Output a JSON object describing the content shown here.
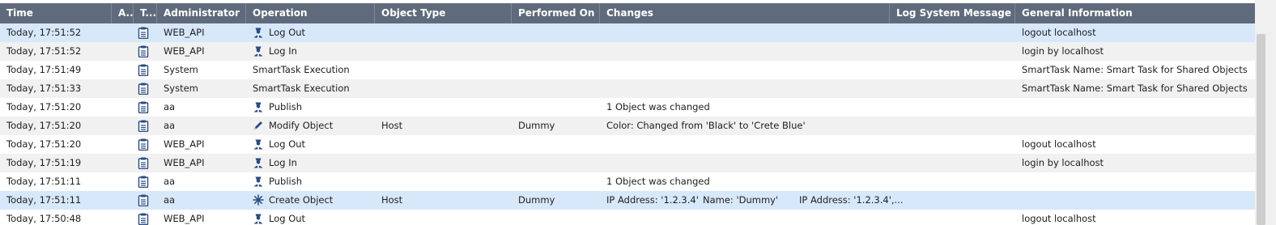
{
  "columns": [
    "Time",
    "A...",
    "T...",
    "Administrator",
    "Operation",
    "Object Type",
    "Performed On",
    "Changes",
    "Log System Message",
    "General Information"
  ],
  "rows": [
    {
      "time": "Today, 17:51:52",
      "admin": "WEB_API",
      "op_icon": "user-icon",
      "operation": "Log Out",
      "object_type": "",
      "performed_on": "",
      "changes": [],
      "general": "logout localhost",
      "state": "selected"
    },
    {
      "time": "Today, 17:51:52",
      "admin": "WEB_API",
      "op_icon": "user-icon",
      "operation": "Log In",
      "object_type": "",
      "performed_on": "",
      "changes": [],
      "general": "login by localhost",
      "state": "alt"
    },
    {
      "time": "Today, 17:51:49",
      "admin": "System",
      "op_icon": "",
      "operation": "SmartTask Execution",
      "object_type": "",
      "performed_on": "",
      "changes": [],
      "general": "SmartTask Name: Smart Task for Shared Objects",
      "state": "normal"
    },
    {
      "time": "Today, 17:51:33",
      "admin": "System",
      "op_icon": "",
      "operation": "SmartTask Execution",
      "object_type": "",
      "performed_on": "",
      "changes": [],
      "general": "SmartTask Name: Smart Task for Shared Objects",
      "state": "alt"
    },
    {
      "time": "Today, 17:51:20",
      "admin": "aa",
      "op_icon": "user-icon",
      "operation": "Publish",
      "object_type": "",
      "performed_on": "",
      "changes": [
        "1 Object was changed"
      ],
      "general": "",
      "state": "normal"
    },
    {
      "time": "Today, 17:51:20",
      "admin": "aa",
      "op_icon": "pencil-icon",
      "operation": "Modify Object",
      "object_type": "Host",
      "performed_on": "Dummy",
      "changes": [
        "Color: Changed from 'Black' to 'Crete Blue'"
      ],
      "general": "",
      "state": "alt"
    },
    {
      "time": "Today, 17:51:20",
      "admin": "WEB_API",
      "op_icon": "user-icon",
      "operation": "Log Out",
      "object_type": "",
      "performed_on": "",
      "changes": [],
      "general": "logout localhost",
      "state": "normal"
    },
    {
      "time": "Today, 17:51:19",
      "admin": "WEB_API",
      "op_icon": "user-icon",
      "operation": "Log In",
      "object_type": "",
      "performed_on": "",
      "changes": [],
      "general": "login by localhost",
      "state": "alt"
    },
    {
      "time": "Today, 17:51:11",
      "admin": "aa",
      "op_icon": "user-icon",
      "operation": "Publish",
      "object_type": "",
      "performed_on": "",
      "changes": [
        "1 Object was changed"
      ],
      "general": "",
      "state": "normal"
    },
    {
      "time": "Today, 17:51:11",
      "admin": "aa",
      "op_icon": "asterisk-icon",
      "operation": "Create Object",
      "object_type": "Host",
      "performed_on": "Dummy",
      "changes": [
        "IP Address: '1.2.3.4'",
        "Name: 'Dummy'",
        "IP Address: '1.2.3.4',..."
      ],
      "general": "",
      "state": "selected"
    },
    {
      "time": "Today, 17:50:48",
      "admin": "WEB_API",
      "op_icon": "user-icon",
      "operation": "Log Out",
      "object_type": "",
      "performed_on": "",
      "changes": [],
      "general": "logout localhost",
      "state": "normal"
    }
  ],
  "type_icon": "clipboard-icon",
  "colors": {
    "header_bg": "#5f6b7c",
    "selected_row": "#d7e8fb",
    "alt_row": "#f1f1f1",
    "icon_blue": "#2a4b80"
  }
}
